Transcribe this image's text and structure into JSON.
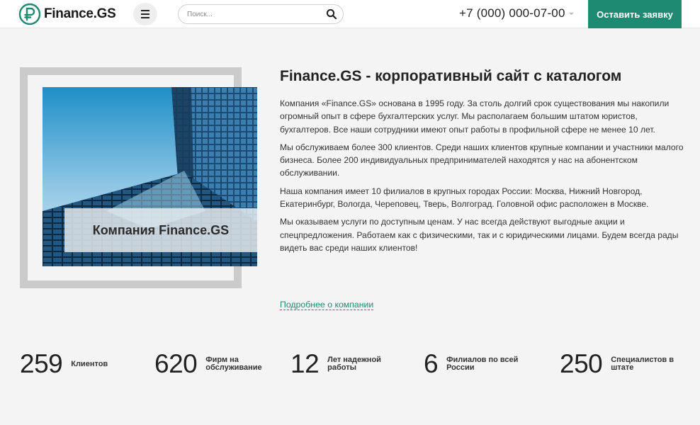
{
  "header": {
    "logo_text": "Finance.GS",
    "search_placeholder": "Поиск...",
    "phone": "+7 (000) 000-07-00",
    "cta_label": "Оставить заявку",
    "accent_color": "#1f8a72"
  },
  "about": {
    "image_caption": "Компания Finance.GS",
    "title": "Finance.GS - корпоративный сайт с каталогом",
    "paragraphs": [
      "Компания «Finance.GS» основана в 1995 году. За столь долгий срок существования мы накопили огромный опыт в сфере бухгалтерских услуг. Мы располагаем большим штатом юристов, бухгалтеров. Все наши сотрудники имеют опыт работы в профильной сфере не менее 10 лет.",
      "Мы обслуживаем более 300 клиентов. Среди наших клиентов крупные компании и участники малого бизнеса. Более 200 индивидуальных предпринимателей находятся у нас на абонентском обслуживании.",
      "Наша компания имеет 10 филиалов в крупных городах России: Москва, Нижний Новгород, Екатеринбург, Вологда, Череповец, Тверь, Волгоград. Головной офис расположен в Москве.",
      "Мы оказываем услуги по доступным ценам. У нас всегда действуют выгодные акции и спецпредложения. Работаем как с физическими, так и с юридическими лицами. Будем всегда рады видеть вас среди наших клиентов!"
    ],
    "more_link": "Подробнее о компании"
  },
  "stats": [
    {
      "value": "259",
      "label_1": "Клиентов",
      "label_2": ""
    },
    {
      "value": "620",
      "label_1": "Фирм на",
      "label_2": "обслуживание"
    },
    {
      "value": "12",
      "label_1": "Лет надежной",
      "label_2": "работы"
    },
    {
      "value": "6",
      "label_1": "Филиалов по всей",
      "label_2": "России"
    },
    {
      "value": "250",
      "label_1": "Специалистов в",
      "label_2": "штате"
    }
  ]
}
